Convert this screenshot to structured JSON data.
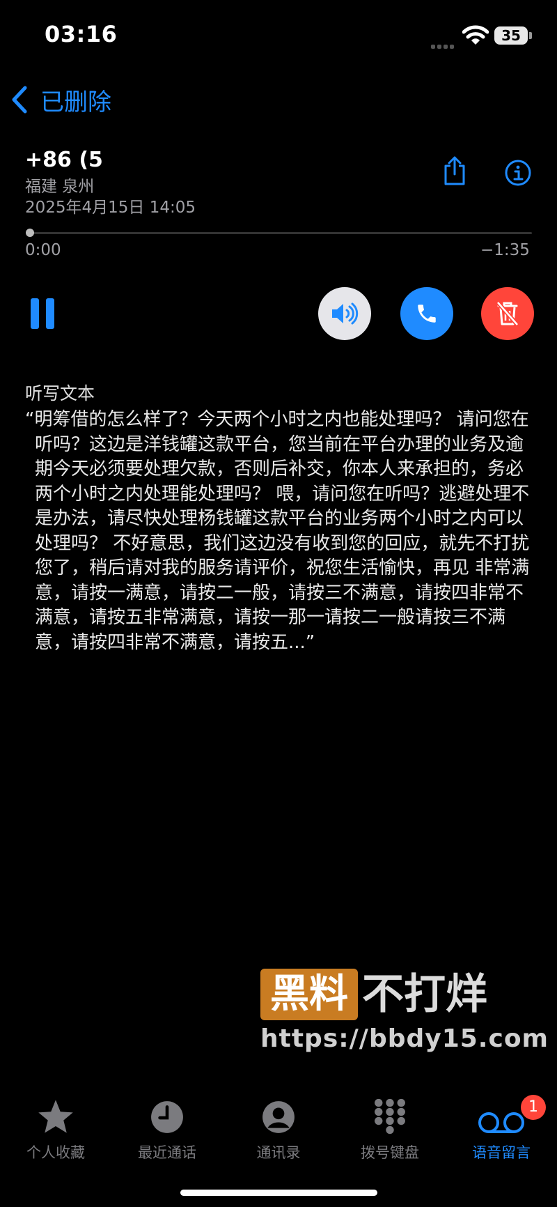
{
  "status_bar": {
    "time": "03:16",
    "battery": "35"
  },
  "nav": {
    "back_label": "已删除"
  },
  "voicemail": {
    "phone": "+86 (5",
    "location": "福建 泉州",
    "datetime": "2025年4月15日 14:05",
    "elapsed": "0:00",
    "remaining": "−1:35",
    "progress": 0
  },
  "transcript": {
    "label": "听写文本",
    "text": "“明筹借的怎么样了？今天两个小时之内也能处理吗？ 请问您在听吗？这边是洋钱罐这款平台，您当前在平台办理的业务及逾期今天必须要处理欠款，否则后补交，你本人来承担的，务必两个小时之内处理能处理吗？ 喂，请问您在听吗？逃避处理不是办法，请尽快处理杨钱罐这款平台的业务两个小时之内可以处理吗？ 不好意思，我们这边没有收到您的回应，就先不打扰您了，稍后请对我的服务请评价，祝您生活愉快，再见 非常满意，请按一满意，请按二一般，请按三不满意，请按四非常不满意，请按五非常满意，请按一那一请按二一般请按三不满意，请按四非常不满意，请按五...”"
  },
  "watermark": {
    "box": "黑料",
    "text": "不打烊",
    "url": "https://bbdy15.com"
  },
  "tabs": [
    {
      "label": "个人收藏",
      "icon": "star-icon"
    },
    {
      "label": "最近通话",
      "icon": "clock-icon"
    },
    {
      "label": "通讯录",
      "icon": "person-icon"
    },
    {
      "label": "拨号键盘",
      "icon": "keypad-icon"
    },
    {
      "label": "语音留言",
      "icon": "voicemail-icon",
      "badge": "1"
    }
  ],
  "colors": {
    "accent": "#1f8bff",
    "destructive": "#ff453a",
    "background": "#000000"
  }
}
